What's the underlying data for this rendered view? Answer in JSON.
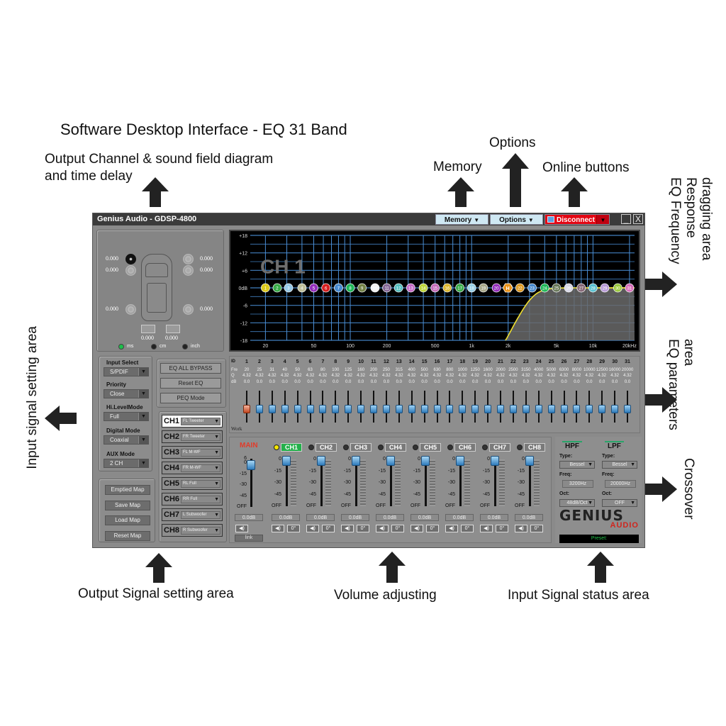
{
  "annotations": {
    "title": "Software Desktop Interface - EQ 31 Band",
    "output_channel": "Output Channel & sound field diagram",
    "output_channel_2": "and time delay",
    "options": "Options",
    "memory": "Memory",
    "online_buttons": "Online buttons",
    "eq_freq_response_1": "EQ Frequency",
    "eq_freq_response_2": "Response",
    "eq_freq_response_3": "dragging area",
    "eq_params_1": "EQ parameters",
    "eq_params_2": "area",
    "crossover": "Crossover",
    "input_signal_setting": "Input signal setting area",
    "output_signal_setting": "Output Signal setting area",
    "volume_adjusting": "Volume adjusting",
    "input_signal_status": "Input Signal status area"
  },
  "window": {
    "title": "Genius Audio - GDSP-4800",
    "memory_btn": "Memory",
    "options_btn": "Options",
    "disconnect_btn": "Disconnect",
    "dropdown_glyph": "▼",
    "minimize_glyph": "_",
    "close_glyph": "X"
  },
  "sound_field": {
    "delays": {
      "front_left_1": "0.000",
      "front_left_2": "0.000",
      "front_right_1": "0.000",
      "front_right_2": "0.000",
      "rear_left": "0.000",
      "rear_right": "0.000",
      "sub_left": "0.000",
      "sub_right": "0.000"
    },
    "units": [
      {
        "label": "ms",
        "selected": true
      },
      {
        "label": "cm",
        "selected": false
      },
      {
        "label": "inch",
        "selected": false
      }
    ]
  },
  "eq_graph": {
    "channel_label": "CH 1",
    "y_ticks": [
      "+18",
      "+12",
      "+6",
      "0dB",
      "-6",
      "-12",
      "-18"
    ],
    "x_ticks": [
      "20",
      "50",
      "100",
      "200",
      "500",
      "1k",
      "2k",
      "5k",
      "10k",
      "20kHz"
    ],
    "band_node_colors": [
      "#e8d31a",
      "#3bb34a",
      "#9fd2f0",
      "#c8c8a0",
      "#9b2fc4",
      "#e02020",
      "#4a90d8",
      "#1fbf5a",
      "#7a8a4a",
      "#ffffff",
      "#8a6a9a",
      "#5ac8c8",
      "#d070d0",
      "#c8e03a",
      "#d070c0",
      "#e8c030",
      "#3bb34a",
      "#a0d8f0",
      "#b0b090",
      "#9b2fc4",
      "#e02020",
      "#e8a020",
      "#4a90d8",
      "#1fbf5a",
      "#6a7a5a",
      "#e0e0f0",
      "#8a6a7a",
      "#5ac8d8",
      "#c0a0e0",
      "#a0d040",
      "#e070c0",
      "#f0d020"
    ],
    "hpf_curve_color": "#f0e030",
    "grid_color": "#4a8fd6"
  },
  "input_settings": {
    "input_select": {
      "label": "Input Select",
      "value": "S/PDIF"
    },
    "priority": {
      "label": "Priority",
      "value": "Close"
    },
    "hi_level_mode": {
      "label": "Hi.LevelMode",
      "value": "Full"
    },
    "digital_mode": {
      "label": "Digital Mode",
      "value": "Coaxial"
    },
    "aux_mode": {
      "label": "AUX Mode",
      "value": "2 CH"
    }
  },
  "eq_buttons": {
    "bypass": "EQ ALL BYPASS",
    "reset": "Reset EQ",
    "peq": "PEQ Mode"
  },
  "channel_map": [
    {
      "ch": "CH1",
      "assign": "FL Tweeter",
      "selected": true
    },
    {
      "ch": "CH2",
      "assign": "FR Tweeter",
      "selected": false
    },
    {
      "ch": "CH3",
      "assign": "FL M-WF",
      "selected": false
    },
    {
      "ch": "CH4",
      "assign": "FR M-WF",
      "selected": false
    },
    {
      "ch": "CH5",
      "assign": "RL Full",
      "selected": false
    },
    {
      "ch": "CH6",
      "assign": "RR Full",
      "selected": false
    },
    {
      "ch": "CH7",
      "assign": "L Subwoofer",
      "selected": false
    },
    {
      "ch": "CH8",
      "assign": "R Subwoofer",
      "selected": false
    }
  ],
  "map_buttons": {
    "emptied": "Emptied Map",
    "save": "Save Map",
    "load": "Load Map",
    "reset": "Reset Map"
  },
  "eq_params": {
    "row_labels": {
      "id": "ID",
      "freq": "Fre",
      "q": "Q",
      "db": "dB"
    },
    "work_label": "Work",
    "selected_band": 1,
    "bands": [
      {
        "id": "1",
        "freq": "20",
        "q": "4.32",
        "db": "0.0"
      },
      {
        "id": "2",
        "freq": "25",
        "q": "4.32",
        "db": "0.0"
      },
      {
        "id": "3",
        "freq": "31",
        "q": "4.32",
        "db": "0.0"
      },
      {
        "id": "4",
        "freq": "40",
        "q": "4.32",
        "db": "0.0"
      },
      {
        "id": "5",
        "freq": "50",
        "q": "4.32",
        "db": "0.0"
      },
      {
        "id": "6",
        "freq": "63",
        "q": "4.32",
        "db": "0.0"
      },
      {
        "id": "7",
        "freq": "80",
        "q": "4.32",
        "db": "0.0"
      },
      {
        "id": "8",
        "freq": "100",
        "q": "4.32",
        "db": "0.0"
      },
      {
        "id": "9",
        "freq": "125",
        "q": "4.32",
        "db": "0.0"
      },
      {
        "id": "10",
        "freq": "160",
        "q": "4.32",
        "db": "0.0"
      },
      {
        "id": "11",
        "freq": "200",
        "q": "4.32",
        "db": "0.0"
      },
      {
        "id": "12",
        "freq": "250",
        "q": "4.32",
        "db": "0.0"
      },
      {
        "id": "13",
        "freq": "315",
        "q": "4.32",
        "db": "0.0"
      },
      {
        "id": "14",
        "freq": "400",
        "q": "4.32",
        "db": "0.0"
      },
      {
        "id": "15",
        "freq": "500",
        "q": "4.32",
        "db": "0.0"
      },
      {
        "id": "16",
        "freq": "630",
        "q": "4.32",
        "db": "0.0"
      },
      {
        "id": "17",
        "freq": "800",
        "q": "4.32",
        "db": "0.0"
      },
      {
        "id": "18",
        "freq": "1000",
        "q": "4.32",
        "db": "0.0"
      },
      {
        "id": "19",
        "freq": "1250",
        "q": "4.32",
        "db": "0.0"
      },
      {
        "id": "20",
        "freq": "1600",
        "q": "4.32",
        "db": "0.0"
      },
      {
        "id": "21",
        "freq": "2000",
        "q": "4.32",
        "db": "0.0"
      },
      {
        "id": "22",
        "freq": "2500",
        "q": "4.32",
        "db": "0.0"
      },
      {
        "id": "23",
        "freq": "3150",
        "q": "4.32",
        "db": "0.0"
      },
      {
        "id": "24",
        "freq": "4000",
        "q": "4.32",
        "db": "0.0"
      },
      {
        "id": "25",
        "freq": "5000",
        "q": "4.32",
        "db": "0.0"
      },
      {
        "id": "26",
        "freq": "6300",
        "q": "4.32",
        "db": "0.0"
      },
      {
        "id": "27",
        "freq": "8000",
        "q": "4.32",
        "db": "0.0"
      },
      {
        "id": "28",
        "freq": "10000",
        "q": "4.32",
        "db": "0.0"
      },
      {
        "id": "29",
        "freq": "12500",
        "q": "4.32",
        "db": "0.0"
      },
      {
        "id": "30",
        "freq": "16000",
        "q": "4.32",
        "db": "0.0"
      },
      {
        "id": "31",
        "freq": "20000",
        "q": "4.32",
        "db": "0.0"
      }
    ]
  },
  "volume": {
    "main_label": "MAIN",
    "main_scale": [
      "6",
      "0",
      "-15",
      "-30",
      "-45",
      "OFF"
    ],
    "ch_scale": [
      "0",
      "-15",
      "-30",
      "-45",
      "OFF"
    ],
    "main_value": "0.0dB",
    "link_label": "link",
    "mute_glyph": "◀)",
    "channels": [
      {
        "name": "CH1",
        "active": true,
        "value": "0.0dB",
        "phase": "0°"
      },
      {
        "name": "CH2",
        "active": false,
        "value": "0.0dB",
        "phase": "0°"
      },
      {
        "name": "CH3",
        "active": false,
        "value": "0.0dB",
        "phase": "0°"
      },
      {
        "name": "CH4",
        "active": false,
        "value": "0.0dB",
        "phase": "0°"
      },
      {
        "name": "CH5",
        "active": false,
        "value": "0.0dB",
        "phase": "0°"
      },
      {
        "name": "CH6",
        "active": false,
        "value": "0.0dB",
        "phase": "0°"
      },
      {
        "name": "CH7",
        "active": false,
        "value": "0.0dB",
        "phase": "0°"
      },
      {
        "name": "CH8",
        "active": false,
        "value": "0.0dB",
        "phase": "0°"
      }
    ]
  },
  "crossover": {
    "hpf": {
      "title": "HPF",
      "type_label": "Type:",
      "type": "Bessel",
      "freq_label": "Freq:",
      "freq": "3200Hz",
      "oct_label": "Oct:",
      "oct": "48dB/Oct"
    },
    "lpf": {
      "title": "LPF",
      "type_label": "Type:",
      "type": "Bessel",
      "freq_label": "Freq:",
      "freq": "20000Hz",
      "oct_label": "Oct:",
      "oct": "OFF"
    }
  },
  "brand": {
    "line1": "GENIUS",
    "line2": "AUDIO"
  },
  "status": {
    "preset": "Preset:"
  }
}
